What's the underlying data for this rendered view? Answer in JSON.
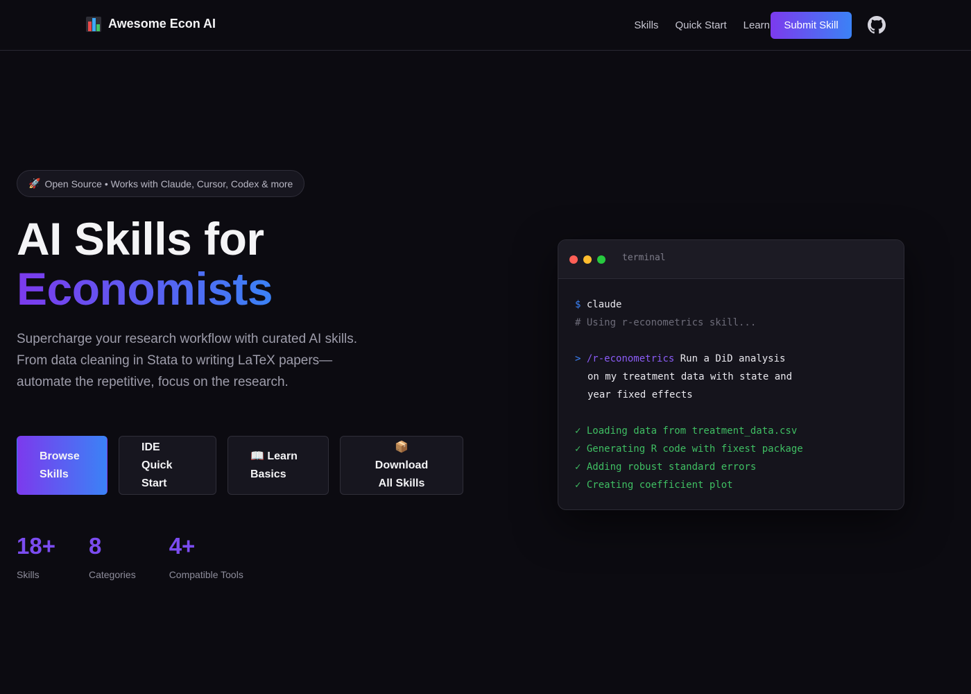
{
  "nav": {
    "brand": "Awesome Econ AI",
    "links": [
      "Skills",
      "Quick Start",
      "Learn"
    ],
    "submit_label": "Submit Skill"
  },
  "hero": {
    "pill": "Open Source • Works with Claude, Cursor, Codex & more",
    "title_line1": "AI Skills for",
    "title_line2": "Economists",
    "lead": "Supercharge your research workflow with curated AI skills. From data cleaning in Stata to writing LaTeX papers—automate the repetitive, focus on the research."
  },
  "ctas": [
    {
      "line1": "Browse",
      "line2": "Skills",
      "icon": ""
    },
    {
      "line1": "IDE Quick",
      "line2": "Start",
      "icon": ""
    },
    {
      "line1": "Learn",
      "line2": "Basics",
      "icon": "📖"
    },
    {
      "line1": "Download",
      "line2": "All Skills",
      "icon": "📦"
    }
  ],
  "stats": [
    {
      "value": "18+",
      "label": "Skills"
    },
    {
      "value": "8",
      "label": "Categories"
    },
    {
      "value": "4+",
      "label": "Compatible Tools"
    }
  ],
  "terminal": {
    "title": "terminal",
    "prompt_symbol": "$",
    "command": "claude",
    "comment": "# Using r-econometrics skill...",
    "arrow": ">",
    "slash_command": "/r-econometrics",
    "request_line1": "Run a DiD analysis",
    "request_line2": "on my treatment data with state and",
    "request_line3": "year fixed effects",
    "steps": [
      "✓ Loading data from treatment_data.csv",
      "✓ Generating R code with fixest package",
      "✓ Adding robust standard errors",
      "✓ Creating coefficient plot"
    ]
  },
  "colors": {
    "background": "#0c0b11",
    "accent_purple": "#7c3aed",
    "accent_blue": "#3b82f6",
    "success_green": "#3fbf63"
  }
}
